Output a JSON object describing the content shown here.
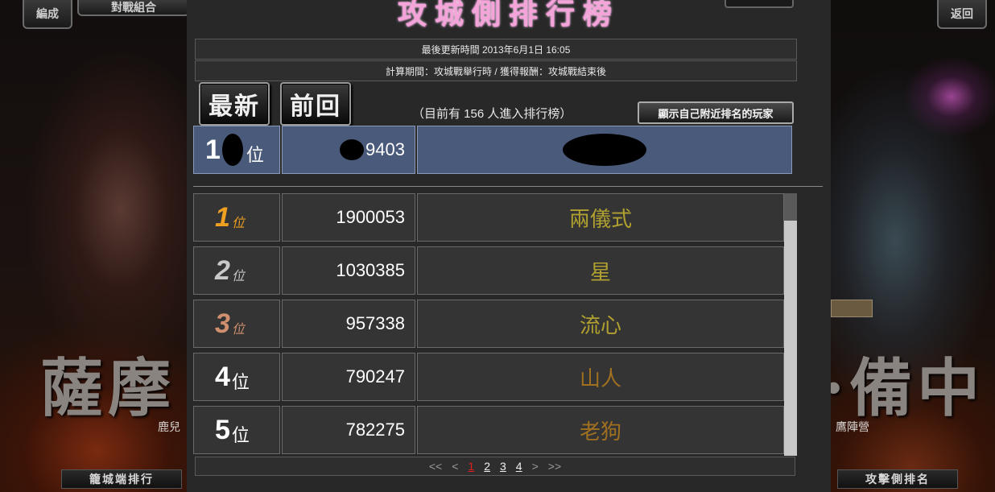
{
  "background": {
    "left_top_button": "編成",
    "left_top_label": "對戰組合",
    "right_top_button": "返回",
    "left_callig": "薩摩",
    "left_sub": "鹿兒",
    "right_callig": "·備中",
    "right_sub": "鷹陣營",
    "left_bottom": "籠城端排行",
    "right_bottom": "攻擊側排名"
  },
  "panel": {
    "title": "攻城側排行榜",
    "updated": "最後更新時間 2013年6月1日 16:05",
    "period": "計算期間：攻城戰舉行時 / 獲得報酬：攻城戰結束後",
    "latest_button": "最新",
    "back_button": "前回",
    "count_text": "（目前有 156 人進入排行榜）",
    "near_button": "顯示自己附近排名的玩家"
  },
  "own_row": {
    "rank_digit": "1",
    "rank_suffix": "位",
    "score": "9403"
  },
  "rows": [
    {
      "rank": "1",
      "suffix": "位",
      "score": "1900053",
      "name": "兩儀式",
      "rank_color": "#f0a020",
      "name_color": "#b0a030"
    },
    {
      "rank": "2",
      "suffix": "位",
      "score": "1030385",
      "name": "星",
      "rank_color": "#c8c8c8",
      "name_color": "#b0a030"
    },
    {
      "rank": "3",
      "suffix": "位",
      "score": "957338",
      "name": "流心",
      "rank_color": "#d09070",
      "name_color": "#b0a030"
    },
    {
      "rank": "4",
      "suffix": "位",
      "score": "790247",
      "name": "山人",
      "rank_color": "#ffffff",
      "name_color": "#a07020"
    },
    {
      "rank": "5",
      "suffix": "位",
      "score": "782275",
      "name": "老狗",
      "rank_color": "#ffffff",
      "name_color": "#a07020"
    }
  ],
  "pager": {
    "first": "<<",
    "prev": "<",
    "pages": [
      "1",
      "2",
      "3",
      "4"
    ],
    "current": "1",
    "next": ">",
    "last": ">>"
  }
}
